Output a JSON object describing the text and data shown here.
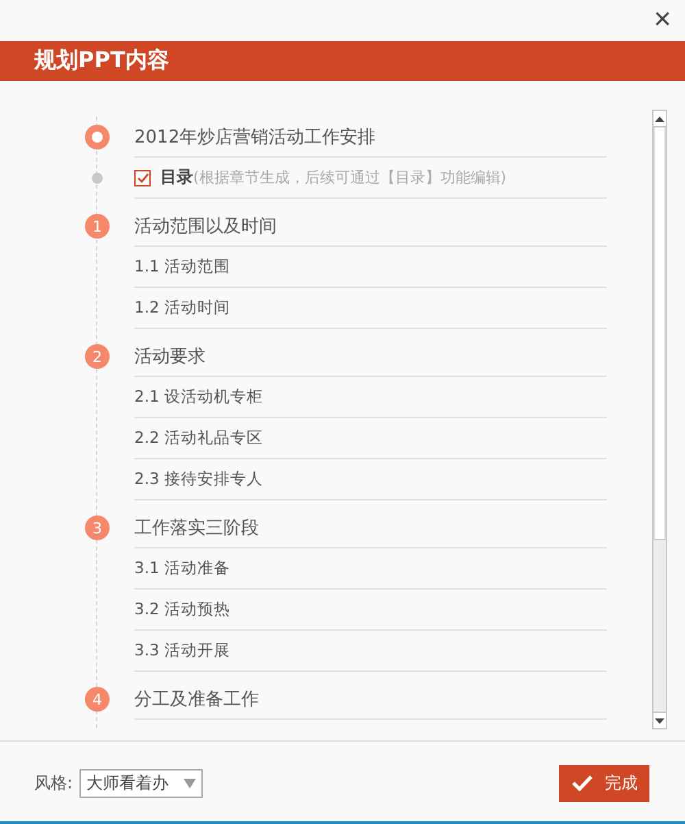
{
  "close_icon": "×",
  "title": "规划PPT内容",
  "outline": [
    {
      "kind": "cover",
      "text": "2012年炒店营销活动工作安排"
    },
    {
      "kind": "toc",
      "label": "目录",
      "hint": "(根据章节生成，后续可通过【目录】功能编辑)",
      "checked": true
    },
    {
      "kind": "section",
      "number": "1",
      "text": "活动范围以及时间",
      "children": [
        {
          "text": "1.1 活动范围"
        },
        {
          "text": "1.2 活动时间"
        }
      ]
    },
    {
      "kind": "section",
      "number": "2",
      "text": "活动要求",
      "children": [
        {
          "text": "2.1 设活动机专柜"
        },
        {
          "text": "2.2 活动礼品专区"
        },
        {
          "text": "2.3 接待安排专人"
        }
      ]
    },
    {
      "kind": "section",
      "number": "3",
      "text": "工作落实三阶段",
      "children": [
        {
          "text": "3.1 活动准备"
        },
        {
          "text": "3.2 活动预热"
        },
        {
          "text": "3.3 活动开展"
        }
      ]
    },
    {
      "kind": "section",
      "number": "4",
      "text": "分工及准备工作"
    }
  ],
  "footer": {
    "style_label": "风格:",
    "style_value": "大师看着办",
    "done_button": "完成"
  }
}
